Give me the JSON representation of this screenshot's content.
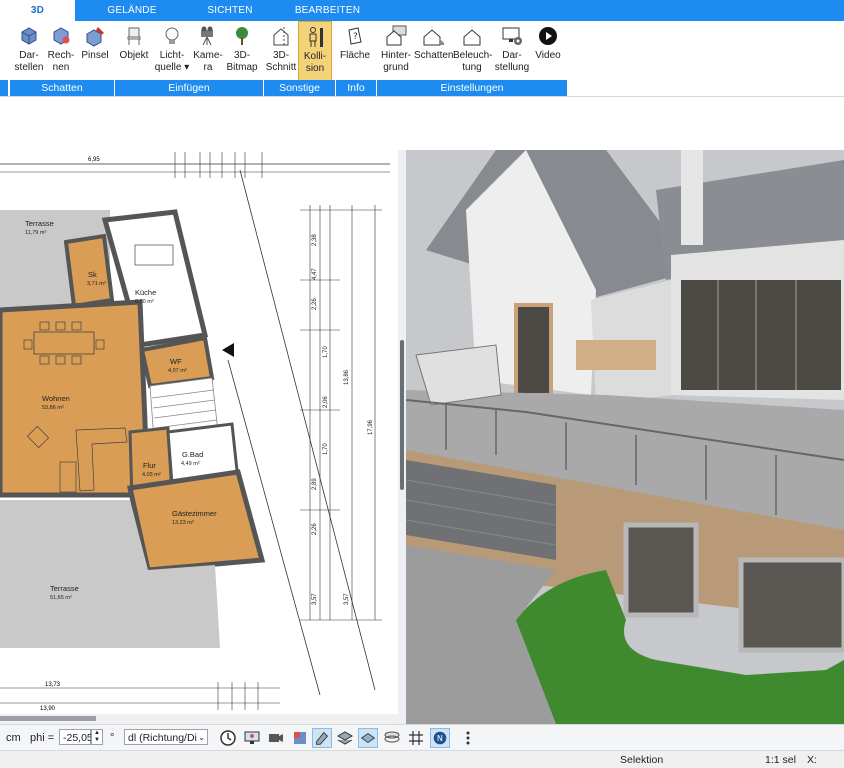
{
  "tabs": [
    {
      "label": "3D",
      "active": true
    },
    {
      "label": "GELÄNDE",
      "active": false
    },
    {
      "label": "SICHTEN",
      "active": false
    },
    {
      "label": "BEARBEITEN",
      "active": false
    }
  ],
  "ribbon": {
    "buttons": [
      {
        "id": "darstellen",
        "line1": "Dar-",
        "line2": "stellen",
        "icon": "render-cube-icon"
      },
      {
        "id": "rechnen",
        "line1": "Rech-",
        "line2": "nen",
        "icon": "calc-cube-icon"
      },
      {
        "id": "pinsel",
        "line1": "Pinsel",
        "line2": "",
        "icon": "brush-cube-icon"
      },
      {
        "id": "objekt",
        "line1": "Objekt",
        "line2": "",
        "icon": "chair-icon"
      },
      {
        "id": "lichtquelle",
        "line1": "Licht-",
        "line2": "quelle ▾",
        "icon": "lightbulb-icon"
      },
      {
        "id": "kamera",
        "line1": "Kame-",
        "line2": "ra",
        "icon": "camera-icon"
      },
      {
        "id": "bitmap3d",
        "line1": "3D-",
        "line2": "Bitmap",
        "icon": "tree-icon"
      },
      {
        "id": "schnitt3d",
        "line1": "3D-",
        "line2": "Schnitt",
        "icon": "section-icon"
      },
      {
        "id": "kollision",
        "line1": "Kolli-",
        "line2": "sion",
        "icon": "person-icon",
        "active": true
      },
      {
        "id": "flaeche",
        "line1": "Fläche",
        "line2": "",
        "icon": "area-info-icon"
      },
      {
        "id": "hintergrund",
        "line1": "Hinter-",
        "line2": "grund",
        "icon": "house-bg-icon"
      },
      {
        "id": "schatten2",
        "line1": "Schatten",
        "line2": "",
        "icon": "house-shadow-icon"
      },
      {
        "id": "beleuchtung",
        "line1": "Beleuch-",
        "line2": "tung",
        "icon": "house-light-icon"
      },
      {
        "id": "darstellung",
        "line1": "Dar-",
        "line2": "stellung",
        "icon": "monitor-gear-icon"
      },
      {
        "id": "video",
        "line1": "Video",
        "line2": "",
        "icon": "play-icon"
      }
    ],
    "groups": [
      "Schatten",
      "Einfügen",
      "Sonstige",
      "Info",
      "Einstellungen"
    ]
  },
  "plan": {
    "rooms": [
      {
        "name": "Terrasse",
        "area": "11,79 m²"
      },
      {
        "name": "Sk",
        "area": "3,71 m²"
      },
      {
        "name": "Küche",
        "area": "0,00 m²"
      },
      {
        "name": "WF",
        "area": "4,07 m²"
      },
      {
        "name": "Wohnen",
        "area": "53,86 m²"
      },
      {
        "name": "G.Bad",
        "area": "4,49 m²"
      },
      {
        "name": "Flur",
        "area": "4,03 m²"
      },
      {
        "name": "Gästezimmer",
        "area": "13,23 m²"
      },
      {
        "name": "Terrasse",
        "area": "51,65 m²"
      }
    ],
    "dims_top": [
      "6,95"
    ],
    "dims_bottom": [
      "13,73",
      "13,90"
    ],
    "dims_right": [
      "2,38",
      "4,47",
      "2,26",
      "1,70",
      "2,06",
      "1,70",
      "2,89",
      "2,26",
      "3,57",
      "3,57",
      "13,86",
      "17,96"
    ]
  },
  "toolbar": {
    "unit": "cm",
    "phi_label": "phi =",
    "phi_value": "-25,05",
    "deg": "°",
    "dl_value": "dl (Richtung/Di"
  },
  "status": {
    "mode": "Selektion",
    "scale": "1:1 sel",
    "x_label": "X:"
  }
}
